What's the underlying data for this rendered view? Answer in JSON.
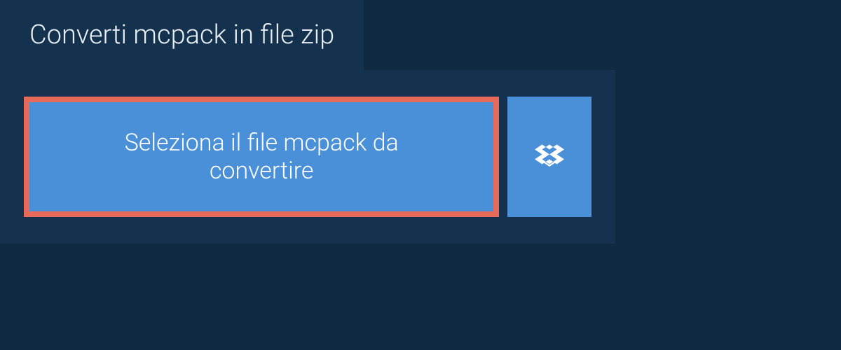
{
  "tab": {
    "title": "Converti mcpack in file zip"
  },
  "buttons": {
    "select_file_label": "Seleziona il file mcpack da convertire"
  },
  "colors": {
    "background": "#0f2940",
    "panel": "#14324e",
    "button": "#4a90d9",
    "button_border": "#e86a5a",
    "text_light": "#ffffff",
    "text_tab": "#e8eef3"
  }
}
